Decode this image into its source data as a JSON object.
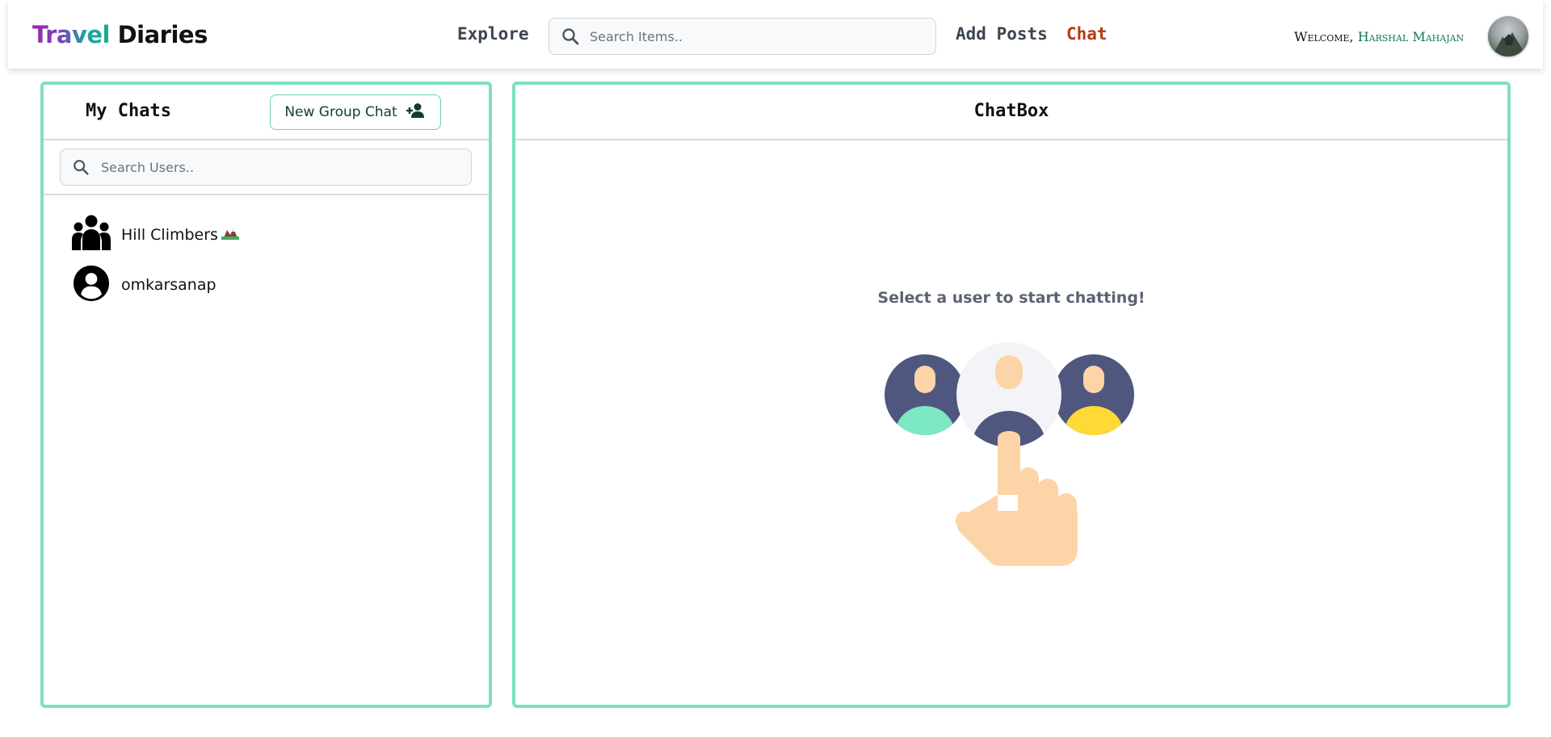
{
  "header": {
    "logo_part1": "Travel",
    "logo_part2": "Diaries",
    "nav_explore": "Explore",
    "search_placeholder": "Search Items..",
    "nav_add_posts": "Add Posts",
    "nav_chat": "Chat",
    "welcome_label": "Welcome,",
    "user_name": "Harshal Mahajan",
    "icons": {
      "search": "search-icon",
      "avatar": "profile-avatar"
    }
  },
  "sidebar": {
    "title": "My Chats",
    "new_group_label": "New Group Chat",
    "search_placeholder": "Search Users..",
    "chats": [
      {
        "name": "Hill Climbers",
        "icon": "group-icon",
        "emoji": "mountain-hut-emoji"
      },
      {
        "name": "omkarsanap",
        "icon": "user-icon"
      }
    ]
  },
  "chatbox": {
    "title": "ChatBox",
    "empty_message": "Select a user to start chatting!"
  },
  "colors": {
    "accent_border": "#7ee0bb",
    "chat_active": "#b83a14",
    "username": "#127a52",
    "logo_purple": "#9c27b0",
    "logo_teal": "#12b08a"
  }
}
